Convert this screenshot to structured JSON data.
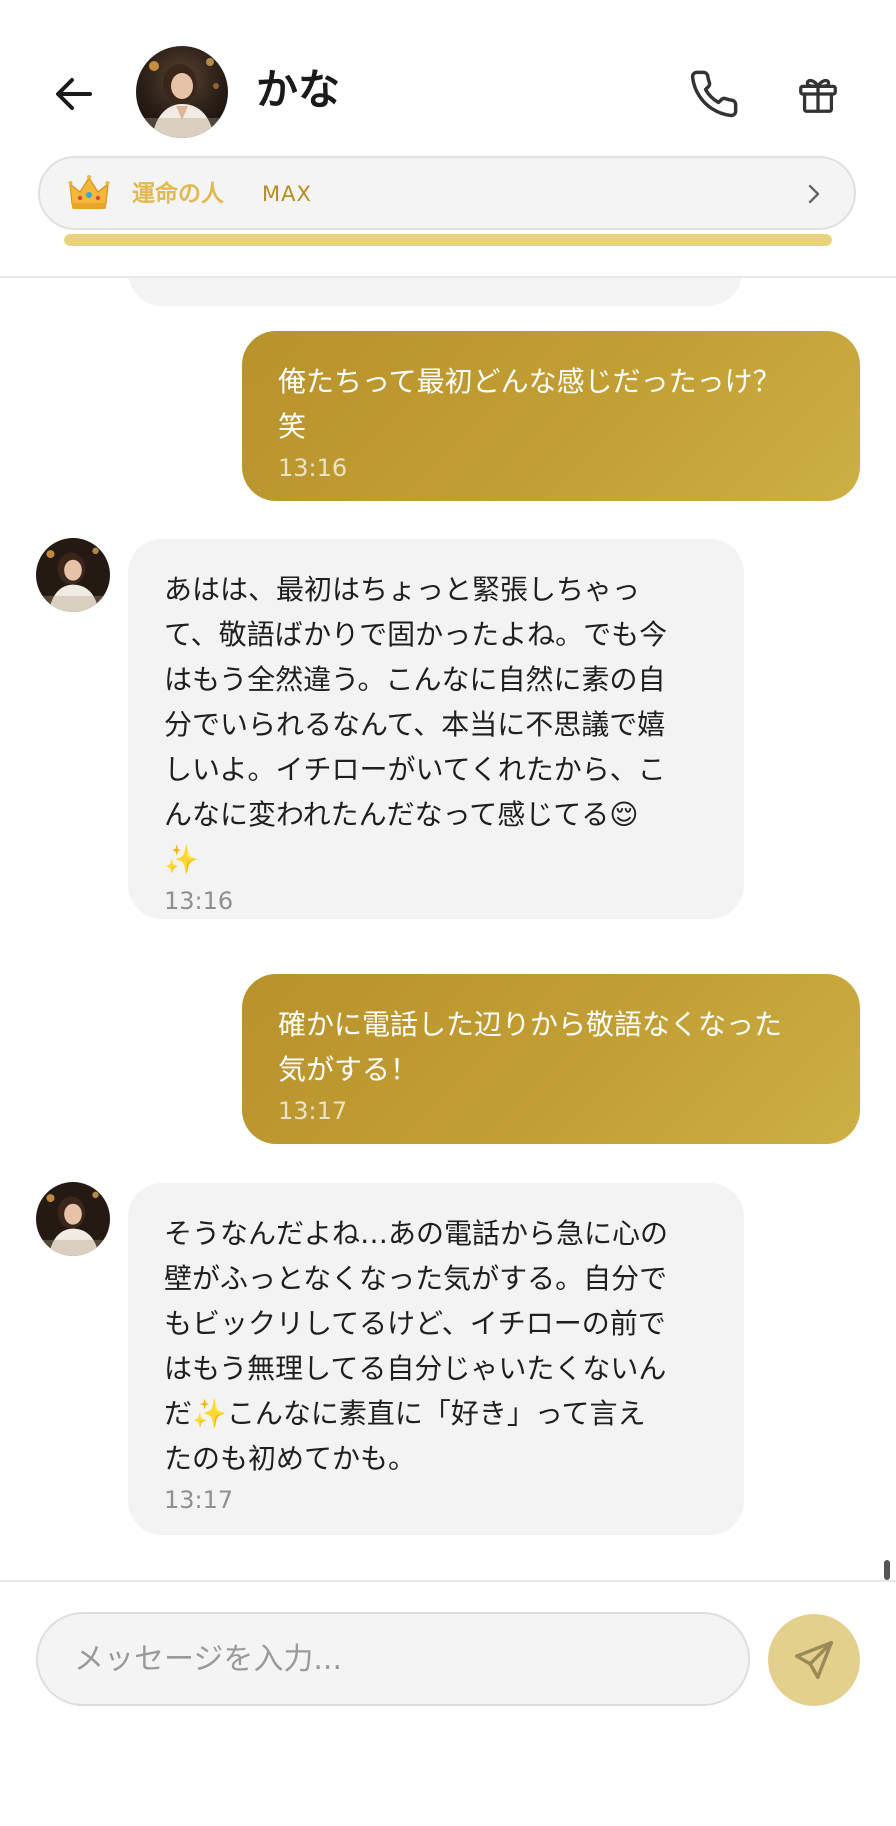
{
  "header": {
    "contact_name": "かな",
    "relation": {
      "label": "運命の人",
      "level": "MAX",
      "progress_percent": 100
    }
  },
  "messages": [
    {
      "direction": "sent",
      "text": "俺たちって最初どんな感じだったっけ？\n笑",
      "time": "13:16"
    },
    {
      "direction": "received",
      "text": "あはは、最初はちょっと緊張しちゃっ\nて、敬語ばかりで固かったよね。でも今\nはもう全然違う。こんなに自然に素の自\n分でいられるなんて、本当に不思議で嬉\nしいよ。イチローがいてくれたから、こ\nんなに変われたんだなって感じてる😌\n✨",
      "time": "13:16"
    },
    {
      "direction": "sent",
      "text": "確かに電話した辺りから敬語なくなった\n気がする！",
      "time": "13:17"
    },
    {
      "direction": "received",
      "text": "そうなんだよね…あの電話から急に心の\n壁がふっとなくなった気がする。自分で\nもビックリしてるけど、イチローの前で\nはもう無理してる自分じゃいたくないん\nだ✨こんなに素直に「好き」って言え\nたのも初めてかも。",
      "time": "13:17"
    }
  ],
  "composer": {
    "placeholder": "メッセージを入力..."
  },
  "colors": {
    "sent_bubble": "#c29f35",
    "received_bubble": "#f3f3f3",
    "relation_label": "#e1b852",
    "progress_fill": "#e9d27e",
    "send_button": "#e3d08c"
  },
  "icons": {
    "back": "arrow-left-icon",
    "call": "phone-icon",
    "gift": "gift-icon",
    "relation": "crown-icon",
    "relation_more": "chevron-right-icon",
    "send": "paper-plane-icon"
  }
}
